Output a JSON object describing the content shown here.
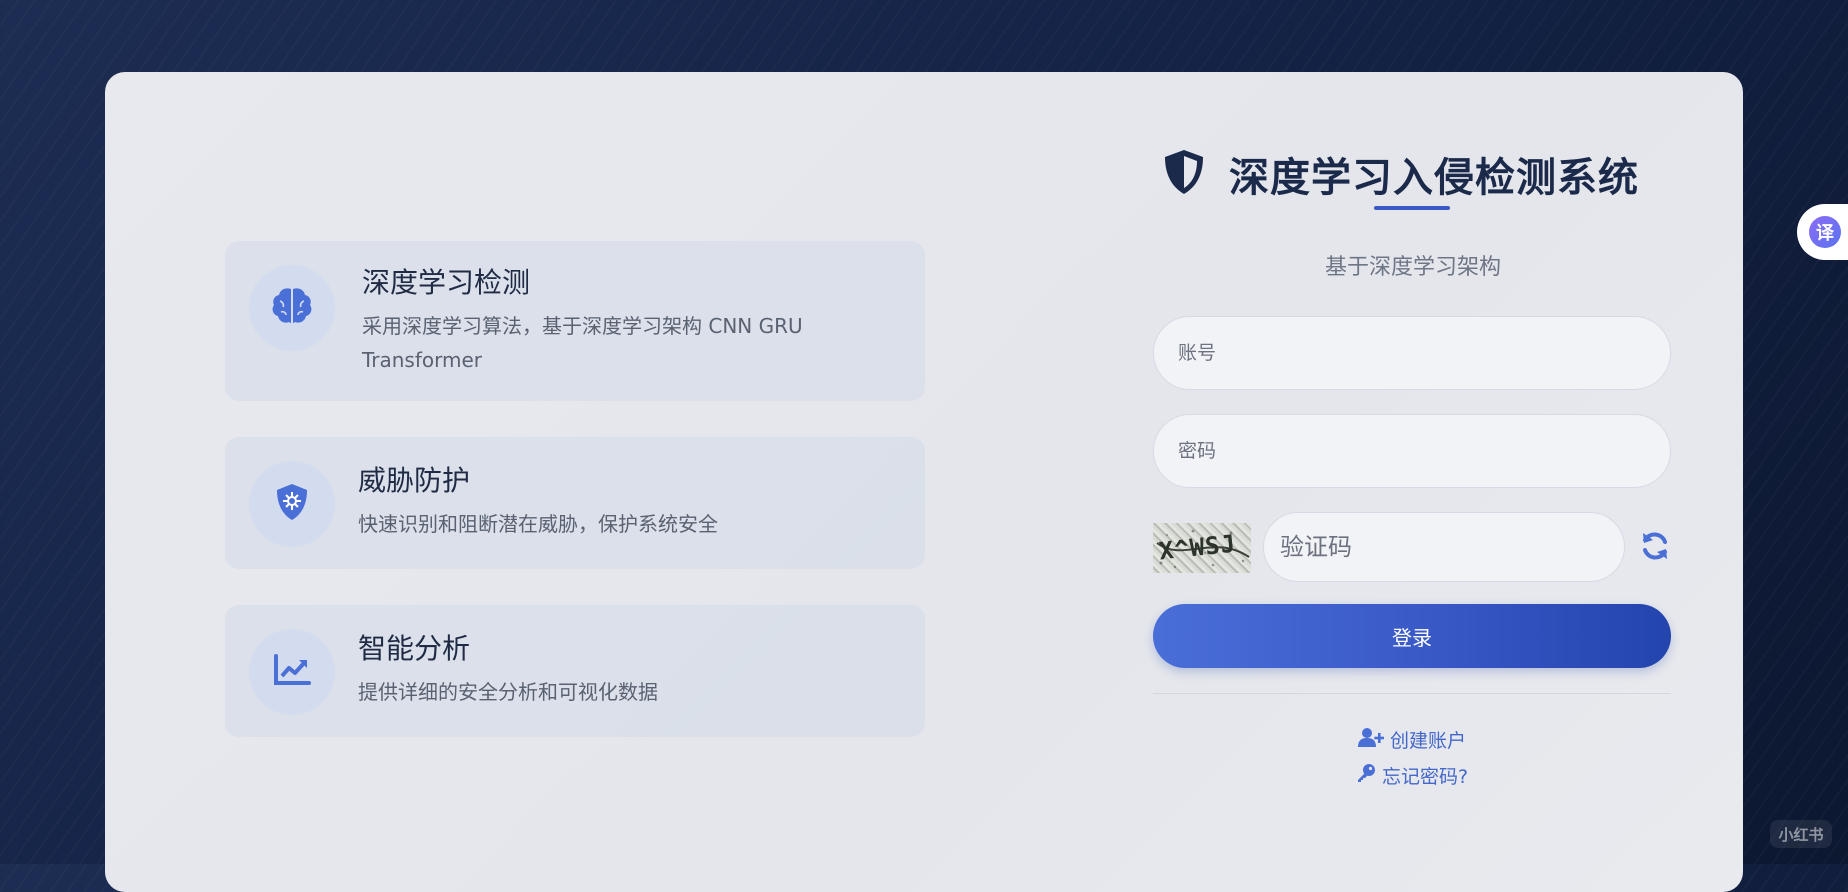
{
  "app": {
    "title": "深度学习入侵检测系统",
    "subtitle": "基于深度学习架构"
  },
  "features": [
    {
      "icon": "brain-icon",
      "title": "深度学习检测",
      "description": "采用深度学习算法，基于深度学习架构 CNN GRU Transformer"
    },
    {
      "icon": "shield-virus-icon",
      "title": "威胁防护",
      "description": "快速识别和阻断潜在威胁，保护系统安全"
    },
    {
      "icon": "chart-line-icon",
      "title": "智能分析",
      "description": "提供详细的安全分析和可视化数据"
    }
  ],
  "form": {
    "account_placeholder": "账号",
    "password_placeholder": "密码",
    "captcha_placeholder": "验证码",
    "captcha_text": "X^WSJ",
    "login_label": "登录",
    "create_account_label": "创建账户",
    "forgot_password_label": "忘记密码?"
  },
  "overlay": {
    "translate_label": "译",
    "watermark": "小红书"
  },
  "colors": {
    "accent": "#3b5bc4",
    "brand_text": "#1b2a4a",
    "link": "#4468c9",
    "background_dark": "#142346"
  }
}
